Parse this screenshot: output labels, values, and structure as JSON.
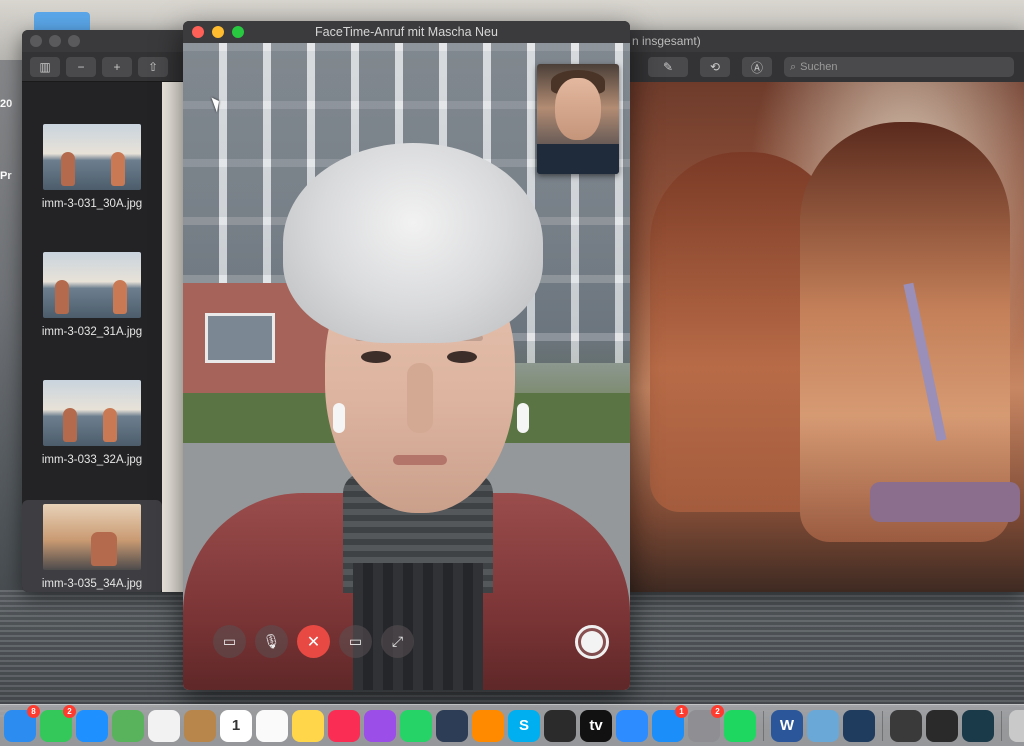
{
  "desktop": {
    "side_text_1": "20",
    "side_text_2": "Pr"
  },
  "preview_window": {
    "thumbnails": [
      {
        "filename": "imm-3-031_30A.jpg",
        "selected": false
      },
      {
        "filename": "imm-3-032_31A.jpg",
        "selected": false
      },
      {
        "filename": "imm-3-033_32A.jpg",
        "selected": false
      },
      {
        "filename": "imm-3-035_34A.jpg",
        "selected": true
      }
    ],
    "toolbar": {
      "sidebar_icon": "sidebar-toggle-icon",
      "zoom_out_icon": "zoom-out-icon",
      "zoom_in_icon": "zoom-in-icon",
      "share_icon": "share-icon"
    }
  },
  "photo_window": {
    "title_fragment": "n insgesamt)",
    "search_placeholder": "Suchen"
  },
  "facetime": {
    "title": "FaceTime-Anruf mit Mascha Neu",
    "controls": {
      "sidebar": "sidebar-icon",
      "mute": "microphone-icon",
      "end_call": "close-icon",
      "video": "camera-icon",
      "fullscreen": "expand-icon",
      "shutter": "live-photo-shutter-icon"
    }
  },
  "dock": {
    "apps": [
      {
        "name": "finder-icon",
        "color": "#2d8cf0",
        "badge": "8"
      },
      {
        "name": "messages-icon",
        "color": "#34c759",
        "badge": "2"
      },
      {
        "name": "chat-bubble-icon",
        "color": "#1e90ff",
        "badge": ""
      },
      {
        "name": "maps-icon",
        "color": "#59b35c",
        "badge": ""
      },
      {
        "name": "photos-icon",
        "color": "#f2f2f2",
        "badge": ""
      },
      {
        "name": "notes-folder-icon",
        "color": "#b8864a",
        "badge": ""
      },
      {
        "name": "calendar-icon",
        "color": "#ffffff",
        "badge": "",
        "label": "1"
      },
      {
        "name": "reminders-icon",
        "color": "#fafafa",
        "badge": ""
      },
      {
        "name": "notes-icon",
        "color": "#ffd54a",
        "badge": ""
      },
      {
        "name": "music-icon",
        "color": "#fa2d55",
        "badge": ""
      },
      {
        "name": "podcasts-icon",
        "color": "#9b4ee8",
        "badge": ""
      },
      {
        "name": "whatsapp-icon",
        "color": "#25d366",
        "badge": ""
      },
      {
        "name": "davinci-icon",
        "color": "#2c3d55",
        "badge": ""
      },
      {
        "name": "audio-icon",
        "color": "#ff8a00",
        "badge": ""
      },
      {
        "name": "skype-icon",
        "color": "#00aff0",
        "badge": "",
        "label": "S"
      },
      {
        "name": "obs-icon",
        "color": "#2b2b2b",
        "badge": ""
      },
      {
        "name": "apple-tv-icon",
        "color": "#111111",
        "badge": "",
        "label": "tv"
      },
      {
        "name": "zoom-icon",
        "color": "#2d8cff",
        "badge": ""
      },
      {
        "name": "app-store-icon",
        "color": "#1c8ef9",
        "badge": "1"
      },
      {
        "name": "system-preferences-icon",
        "color": "#8e8e93",
        "badge": "2"
      },
      {
        "name": "spotify-icon",
        "color": "#1ed760",
        "badge": ""
      },
      {
        "name": "word-icon",
        "color": "#2b579a",
        "badge": "",
        "label": "W"
      },
      {
        "name": "preview-icon",
        "color": "#6aa8d8",
        "badge": ""
      },
      {
        "name": "quicktime-icon",
        "color": "#1f3b5e",
        "badge": ""
      },
      {
        "name": "window-thumb-1-icon",
        "color": "#3a3a3a",
        "badge": ""
      },
      {
        "name": "window-thumb-2-icon",
        "color": "#2a2a2a",
        "badge": ""
      },
      {
        "name": "window-thumb-3-icon",
        "color": "#1a3a4a",
        "badge": ""
      },
      {
        "name": "trash-icon",
        "color": "#c9c9c9",
        "badge": ""
      }
    ]
  }
}
